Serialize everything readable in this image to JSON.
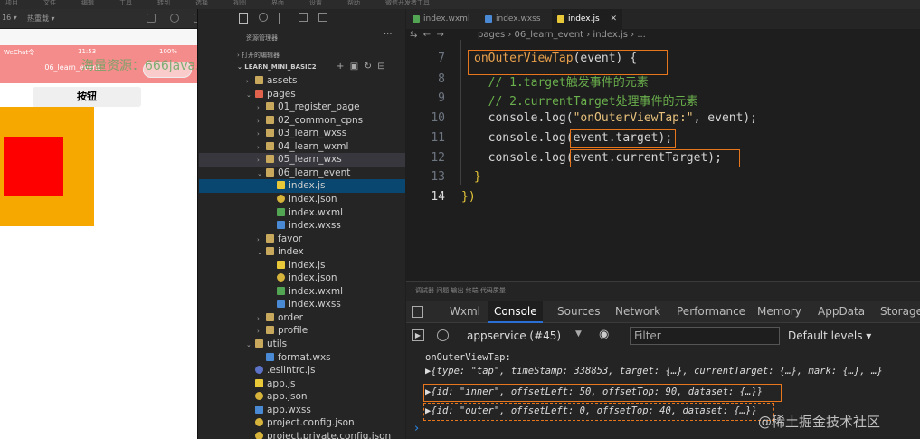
{
  "top_menu": [
    "项目",
    "文件",
    "编辑",
    "工具",
    "转到",
    "选择",
    "视图",
    "界面",
    "设置",
    "帮助",
    "微信开发者工具"
  ],
  "subbar": {
    "device": "16 ▾",
    "mode": "热重载 ▾"
  },
  "simulator": {
    "carrier": "WeChat令",
    "time": "11:53",
    "battery": "100%",
    "nav_title": "06_learn_event",
    "button_label": "按钮",
    "watermark": "海量资源：666java.com"
  },
  "explorer": {
    "title": "资源管理器",
    "open_editors": "› 打开的编辑器",
    "project": "⌄ LEARN_MINI_BASIC2",
    "rows": [
      {
        "indent": 1,
        "arrow": "›",
        "icon": "folder",
        "label": "assets"
      },
      {
        "indent": 1,
        "arrow": "⌄",
        "icon": "folder-red",
        "label": "pages"
      },
      {
        "indent": 2,
        "arrow": "›",
        "icon": "folder",
        "label": "01_register_page"
      },
      {
        "indent": 2,
        "arrow": "›",
        "icon": "folder",
        "label": "02_common_cpns"
      },
      {
        "indent": 2,
        "arrow": "›",
        "icon": "folder",
        "label": "03_learn_wxss"
      },
      {
        "indent": 2,
        "arrow": "›",
        "icon": "folder",
        "label": "04_learn_wxml"
      },
      {
        "indent": 2,
        "arrow": "›",
        "icon": "folder",
        "label": "05_learn_wxs",
        "state": "sel"
      },
      {
        "indent": 2,
        "arrow": "⌄",
        "icon": "folder",
        "label": "06_learn_event"
      },
      {
        "indent": 3,
        "arrow": "",
        "icon": "js",
        "label": "index.js",
        "state": "act"
      },
      {
        "indent": 3,
        "arrow": "",
        "icon": "json",
        "label": "index.json"
      },
      {
        "indent": 3,
        "arrow": "",
        "icon": "wxml",
        "label": "index.wxml"
      },
      {
        "indent": 3,
        "arrow": "",
        "icon": "wxss",
        "label": "index.wxss"
      },
      {
        "indent": 2,
        "arrow": "›",
        "icon": "folder",
        "label": "favor"
      },
      {
        "indent": 2,
        "arrow": "⌄",
        "icon": "folder",
        "label": "index"
      },
      {
        "indent": 3,
        "arrow": "",
        "icon": "js",
        "label": "index.js"
      },
      {
        "indent": 3,
        "arrow": "",
        "icon": "json",
        "label": "index.json"
      },
      {
        "indent": 3,
        "arrow": "",
        "icon": "wxml",
        "label": "index.wxml"
      },
      {
        "indent": 3,
        "arrow": "",
        "icon": "wxss",
        "label": "index.wxss"
      },
      {
        "indent": 2,
        "arrow": "›",
        "icon": "folder",
        "label": "order"
      },
      {
        "indent": 2,
        "arrow": "›",
        "icon": "folder",
        "label": "profile"
      },
      {
        "indent": 1,
        "arrow": "⌄",
        "icon": "folder",
        "label": "utils"
      },
      {
        "indent": 2,
        "arrow": "",
        "icon": "wxss",
        "label": "format.wxs"
      },
      {
        "indent": 1,
        "arrow": "",
        "icon": "rc",
        "label": ".eslintrc.js"
      },
      {
        "indent": 1,
        "arrow": "",
        "icon": "js",
        "label": "app.js"
      },
      {
        "indent": 1,
        "arrow": "",
        "icon": "json",
        "label": "app.json"
      },
      {
        "indent": 1,
        "arrow": "",
        "icon": "wxss",
        "label": "app.wxss"
      },
      {
        "indent": 1,
        "arrow": "",
        "icon": "json",
        "label": "project.config.json"
      },
      {
        "indent": 1,
        "arrow": "",
        "icon": "json",
        "label": "project.private.config.json"
      }
    ]
  },
  "editor": {
    "tabs": [
      {
        "label": "index.wxml",
        "color": "#52a552"
      },
      {
        "label": "index.wxss",
        "color": "#4a8ad4"
      },
      {
        "label": "index.js",
        "color": "#e8c838"
      }
    ],
    "breadcrumb": "pages › 06_learn_event › index.js › ...",
    "lines": [
      {
        "num": "7",
        "text": "onOuterViewTap(event) {"
      },
      {
        "num": "8",
        "text": "  // 1.target触发事件的元素"
      },
      {
        "num": "9",
        "text": "  // 2.currentTarget处理事件的元素"
      },
      {
        "num": "10",
        "text": "  console.log(\"onOuterViewTap:\", event);"
      },
      {
        "num": "11",
        "text": "  console.log(event.target);"
      },
      {
        "num": "12",
        "text": "  console.log(event.currentTarget);"
      },
      {
        "num": "13",
        "text": "}"
      },
      {
        "num": "14",
        "text": "})"
      }
    ]
  },
  "devtools": {
    "top_tabs": "调试器   问题   输出   终端   代码质量",
    "tabs": [
      "Wxml",
      "Console",
      "Sources",
      "Network",
      "Performance",
      "Memory",
      "AppData",
      "Storage"
    ],
    "context": "appservice (#45)",
    "filter_placeholder": "Filter",
    "levels": "Default levels ▾",
    "log_title": "onOuterViewTap:",
    "log_1": "▶{type: \"tap\", timeStamp: 338853, target: {…}, currentTarget: {…}, mark: {…}, …}",
    "log_2": "▶{id: \"inner\", offsetLeft: 50, offsetTop: 90, dataset: {…}}",
    "log_3": "▶{id: \"outer\", offsetLeft: 0, offsetTop: 40, dataset: {…}}",
    "prompt": "›",
    "watermark": "@稀土掘金技术社区"
  }
}
